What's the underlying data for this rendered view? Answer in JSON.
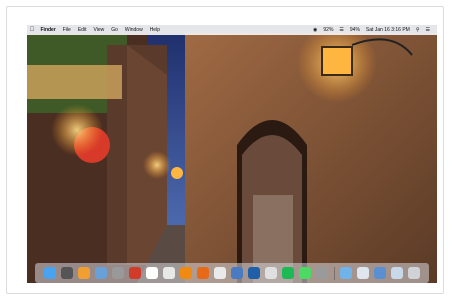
{
  "menubar": {
    "apple_icon": "apple-icon",
    "items": [
      "Finder",
      "File",
      "Edit",
      "View",
      "Go",
      "Window",
      "Help"
    ],
    "status": {
      "battery_percent": "92%",
      "battery_level": "94%",
      "clock": "Sat Jan 16  3:16 PM"
    }
  },
  "desktop": {
    "wallpaper": "medieval stone street at dusk with lanterns",
    "colors": {
      "sky": "#3a4f8c",
      "stone": "#8a5a3a",
      "lantern": "#ffb640"
    }
  },
  "dock": {
    "apps": [
      {
        "name": "finder-icon",
        "color": "#4aa3f0"
      },
      {
        "name": "launchpad-icon",
        "color": "#555555"
      },
      {
        "name": "photos-icon",
        "color": "#f0a030"
      },
      {
        "name": "preview-icon",
        "color": "#6aa0d8"
      },
      {
        "name": "compass-icon",
        "color": "#999999"
      },
      {
        "name": "acrobat-icon",
        "color": "#d23a2a"
      },
      {
        "name": "calendar-icon",
        "color": "#ffffff"
      },
      {
        "name": "maps-icon",
        "color": "#e8e8e8"
      },
      {
        "name": "vlc-icon",
        "color": "#f08a10"
      },
      {
        "name": "firefox-icon",
        "color": "#e66a1a"
      },
      {
        "name": "chrome-icon",
        "color": "#eaeaea"
      },
      {
        "name": "app-folder-icon",
        "color": "#4a7ac0"
      },
      {
        "name": "photoshop-icon",
        "color": "#1f5fa8"
      },
      {
        "name": "contacts-icon",
        "color": "#e0e0e0"
      },
      {
        "name": "spotify-icon",
        "color": "#1db954"
      },
      {
        "name": "messages-icon",
        "color": "#4cd964"
      },
      {
        "name": "settings-icon",
        "color": "#9a9a9a"
      }
    ],
    "trailing": [
      {
        "name": "folder-icon",
        "color": "#6fb3e8"
      },
      {
        "name": "finder-window-icon",
        "color": "#dfe6ee"
      },
      {
        "name": "downloads-icon",
        "color": "#5a8fd0"
      },
      {
        "name": "documents-icon",
        "color": "#c8d8e8"
      },
      {
        "name": "trash-icon",
        "color": "#cfd2d6"
      }
    ]
  }
}
